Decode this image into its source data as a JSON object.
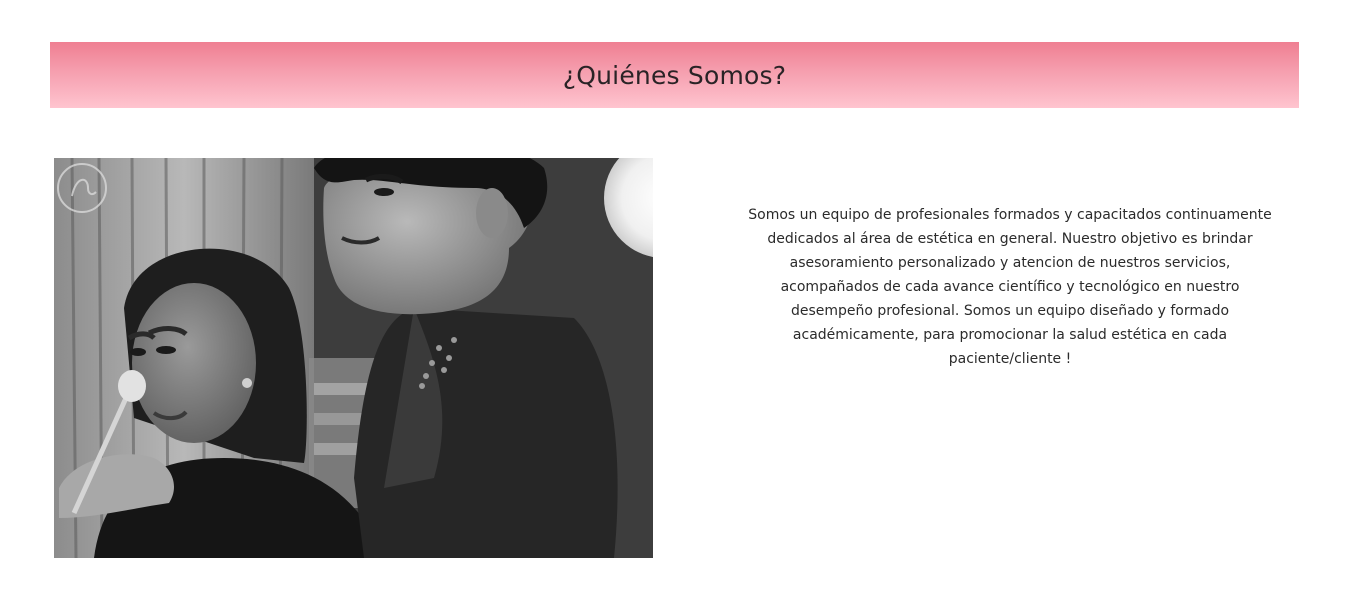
{
  "section": {
    "title": "¿Quiénes Somos?",
    "accent_gradient": [
      "#ef7f92",
      "#ffc4cf"
    ]
  },
  "photo": {
    "icon": "makeup-artist-photo"
  },
  "about": {
    "text": "Somos un equipo de profesionales formados y capacitados continuamente dedicados al área de estética en general. Nuestro objetivo es brindar asesoramiento personalizado y atencion de nuestros servicios, acompañados de cada avance científico y tecnológico en nuestro desempeño profesional. Somos un equipo diseñado y formado académicamente, para promocionar la salud estética en cada paciente/cliente !"
  }
}
